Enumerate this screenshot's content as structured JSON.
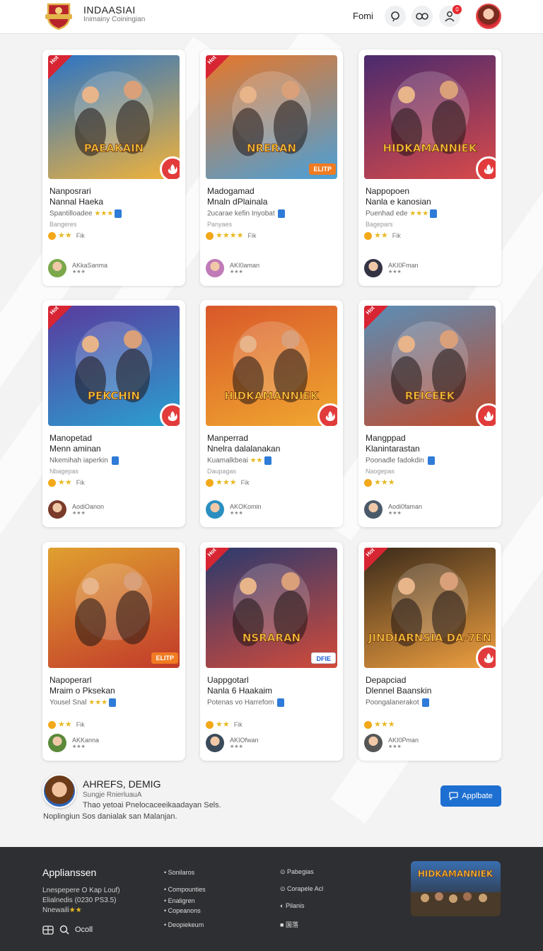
{
  "header": {
    "brand_title": "INDAASIAI",
    "brand_subtitle": "Inimainy Coiningian",
    "nav_link": "Fomi",
    "notification_count": "0"
  },
  "cards": [
    {
      "title1": "Nanposrari",
      "title2": "Nannal Haeka",
      "meta": "Spantilloadee",
      "meta_stars": "★★★",
      "sub": "Bangeres",
      "stars": "★★",
      "rating_text": "Fik",
      "author": "AKkaSanma",
      "author_stars": "★★★",
      "ribbon": "Hot",
      "tag": "",
      "art": "#2a74c6,#f2b33a"
    },
    {
      "title1": "Madogamad",
      "title2": "Mnaln dPlainala",
      "meta": "2ucarae kefin Inyobat",
      "meta_stars": "",
      "sub": "Panyaes",
      "stars": "★★★★",
      "rating_text": "Fik",
      "author": "AKI0aman",
      "author_stars": "★★★",
      "ribbon": "Hot",
      "tag": "ELITP",
      "art": "#e6772a,#4ba0d8"
    },
    {
      "title1": "Nappopoen",
      "title2": "Nanla e kanosian",
      "meta": "Puenhad ede",
      "meta_stars": "★★★",
      "sub": "Bagepars",
      "stars": "★★",
      "rating_text": "Fik",
      "author": "AKI0Fman",
      "author_stars": "★★★",
      "ribbon": "",
      "tag": "",
      "art": "#4a2a6e,#d94a4a"
    },
    {
      "title1": "Manopetad",
      "title2": "Menn aminan",
      "meta": "Nkemihah iaperkin",
      "meta_stars": "",
      "sub": "Nbagepas",
      "stars": "★★",
      "rating_text": "Fik",
      "author": "AodiOanon",
      "author_stars": "★★★",
      "ribbon": "Hot",
      "tag": "",
      "art": "#5a3a9e,#2aa0d0"
    },
    {
      "title1": "Manperrad",
      "title2": "Nnelra dalalanakan",
      "meta": "Kuamalkbeai",
      "meta_stars": "★★",
      "sub": "Daupagas",
      "stars": "★★★",
      "rating_text": "Fik",
      "author": "AKOKomin",
      "author_stars": "★★★",
      "ribbon": "",
      "tag": "",
      "art": "#d9582a,#f0a830"
    },
    {
      "title1": "Mangppad",
      "title2": "Klanintarastan",
      "meta": "Poonadle fadokdin",
      "meta_stars": "",
      "sub": "Naogepas",
      "stars": "★★★",
      "rating_text": "",
      "author": "Aodi0faman",
      "author_stars": "★★★",
      "ribbon": "Hot",
      "tag": "",
      "art": "#5a8fb8,#c24a2a"
    },
    {
      "title1": "Napoperarl",
      "title2": "Mraim o Pksekan",
      "meta": "Yousel Snal",
      "meta_stars": "★★★",
      "sub": "",
      "stars": "★★",
      "rating_text": "Fik",
      "author": "AKKanna",
      "author_stars": "★★★",
      "ribbon": "",
      "tag": "ELITP",
      "art": "#e0a030,#c23a2a"
    },
    {
      "title1": "Uappgotarl",
      "title2": "Nanla 6 Haakaim",
      "meta": "Potenas vo Harrefom",
      "meta_stars": "",
      "sub": "",
      "stars": "★★",
      "rating_text": "Fik",
      "author": "AKIOfwan",
      "author_stars": "★★★",
      "ribbon": "Hot",
      "tag": "DFIE",
      "art": "#2a3a6e,#d24a3a"
    },
    {
      "title1": "Depapciad",
      "title2": "Dlennel Baanskin",
      "meta": "Poongalanerakot",
      "meta_stars": "",
      "sub": "",
      "stars": "★★★",
      "rating_text": "",
      "author": "AKI0Pman",
      "author_stars": "★★★",
      "ribbon": "Hot",
      "tag": "",
      "art": "#3a2a1a,#f0a040"
    }
  ],
  "thumb_banners": [
    "PAEAKAIN",
    "NRERAN",
    "HIDKAMANNIEK",
    "PEKCHIN",
    "HIDKAMANNIEK",
    "REICEEK",
    "",
    "NSRARAN",
    "JINDIARNSIA DA-7EN"
  ],
  "profile": {
    "name": "AHREFS, DEMIG",
    "role": "Sungje RnierluauA",
    "desc": "Thao yetoai Pnelocaceeikaadayan Sels.",
    "note": "Noplingiun Sos danialak san Malanjan.",
    "button": "Applbate"
  },
  "footer": {
    "title": "Applianssen",
    "line1": "Lnespepere O Kap Louf)",
    "line2": "Elialnedis (0230 PS3.5)",
    "line3": "Nnewaili",
    "line3_stars": "★★",
    "tools_label": "Ocoll",
    "col1": [
      "Sonilaros",
      "Compounties",
      "Enaligren",
      "Copeanons",
      "Deopiekeum"
    ],
    "col2": [
      "Pabegias",
      "Corapele Acl",
      "Pilanis",
      "国落"
    ],
    "thumb_text": "HIDKAMANNIEK"
  }
}
